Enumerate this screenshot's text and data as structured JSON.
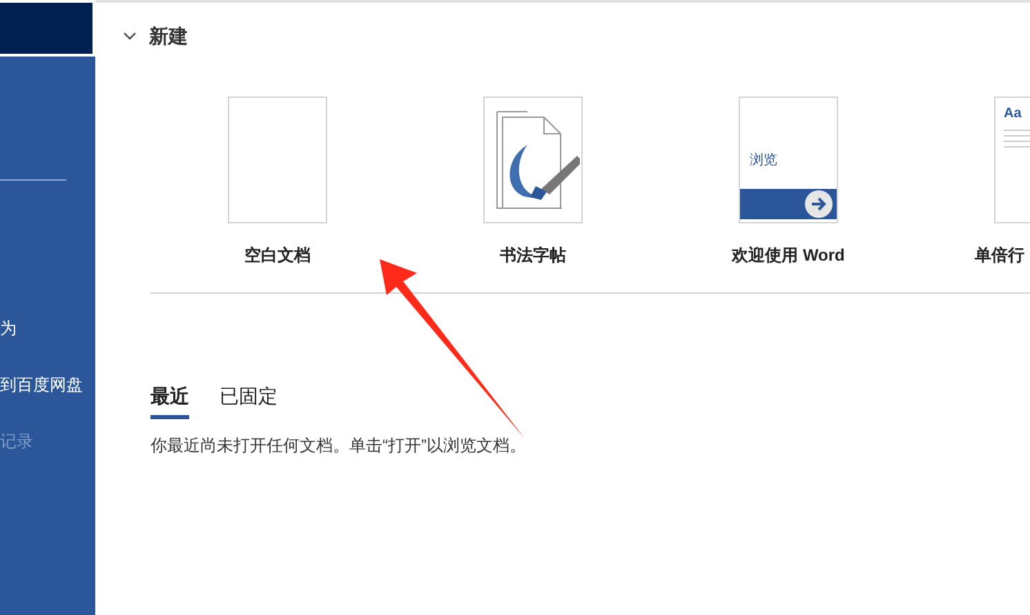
{
  "sidebar": {
    "items": [
      {
        "label": "为",
        "disabled": false
      },
      {
        "label": "到百度网盘",
        "disabled": false
      },
      {
        "label": "记录",
        "disabled": true
      }
    ]
  },
  "new_section": {
    "title": "新建",
    "expanded": true,
    "templates": [
      {
        "kind": "blank",
        "label": "空白文档"
      },
      {
        "kind": "calligraphy",
        "label": "书法字帖"
      },
      {
        "kind": "welcome",
        "label": "欢迎使用 Word",
        "thumb_text": "浏览"
      },
      {
        "kind": "spacing",
        "label": "单倍行",
        "thumb_text": "Aa"
      }
    ]
  },
  "tabs": [
    {
      "label": "最近",
      "selected": true
    },
    {
      "label": "已固定",
      "selected": false
    }
  ],
  "message": "你最近尚未打开任何文档。单击“打开”以浏览文档。"
}
